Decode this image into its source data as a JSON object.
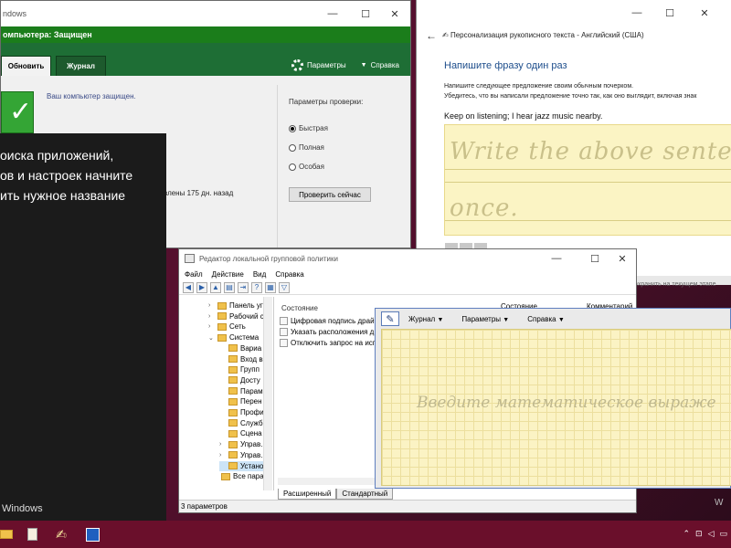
{
  "defender": {
    "title": "ndows",
    "status": "омпьютера: Защищен",
    "tabs": [
      "Обновить",
      "Журнал"
    ],
    "settings_label": "Параметры",
    "help_label": "Справка",
    "protected_msg": "Ваш компьютер защищен.",
    "last_scan": "влены 175 дн. назад",
    "scan_options_title": "Параметры проверки:",
    "options": [
      {
        "label": "Быстрая",
        "selected": true
      },
      {
        "label": "Полная",
        "selected": false
      },
      {
        "label": "Особая",
        "selected": false
      }
    ],
    "scan_now": "Проверить сейчас",
    "controls": {
      "min": "—",
      "max": "☐",
      "close": "✕"
    }
  },
  "handwriting": {
    "window_title": "Персонализация  рукописного текста - Английский (США)",
    "heading": "Напишите фразу один раз",
    "instructions": [
      "Напишите следующее предложение своим обычным почерком.",
      "Убедитесь, что вы написали предложение точно так, как оно выглядит, включая знак"
    ],
    "sentence": "Keep on listening; I hear jazz music nearby.",
    "ghost_line1": "Write the above senten",
    "ghost_line2": "once.",
    "footer_text": "охранить на текущем этапе",
    "controls": {
      "min": "—",
      "max": "☐",
      "close": "✕"
    }
  },
  "black_panel": {
    "lines": [
      "оиска приложений,",
      "ов и настроек начните",
      "ить нужное название"
    ],
    "windows_label": "Windows"
  },
  "gpedit": {
    "title": "Редактор локальной групповой политики",
    "menu": [
      "Файл",
      "Действие",
      "Вид",
      "Справка"
    ],
    "tree": [
      {
        "label": "Панель уг",
        "chev": "›"
      },
      {
        "label": "Рабочий с",
        "chev": "›"
      },
      {
        "label": "Сеть",
        "chev": "›"
      },
      {
        "label": "Система",
        "chev": "⌄"
      },
      {
        "label": "Вариа",
        "chev": ""
      },
      {
        "label": "Вход в",
        "chev": ""
      },
      {
        "label": "Групп",
        "chev": ""
      },
      {
        "label": "Досту",
        "chev": ""
      },
      {
        "label": "Парам",
        "chev": ""
      },
      {
        "label": "Перен",
        "chev": ""
      },
      {
        "label": "Профи",
        "chev": ""
      },
      {
        "label": "Служб",
        "chev": ""
      },
      {
        "label": "Сцена",
        "chev": ""
      },
      {
        "label": "Управ.",
        "chev": "›"
      },
      {
        "label": "Управ.",
        "chev": "›"
      },
      {
        "label": "Устано",
        "chev": ""
      },
      {
        "label": "Все парам",
        "chev": ""
      }
    ],
    "column_state": "Состояние",
    "settings": [
      "Цифровая подпись драйв",
      "Указать расположения д",
      "Отключить запрос на исп"
    ],
    "tabs": [
      "Расширенный",
      "Стандартный"
    ],
    "status": "3 параметров",
    "controls": {
      "min": "—",
      "max": "☐",
      "close": "✕"
    }
  },
  "math_panel": {
    "menus": [
      "Журнал",
      "Параметры",
      "Справка"
    ],
    "col_state": "Состояние",
    "col_comment": "Комментарий",
    "ghost": "Введите математическое выраже"
  },
  "desktop": {
    "watermark": "W"
  }
}
